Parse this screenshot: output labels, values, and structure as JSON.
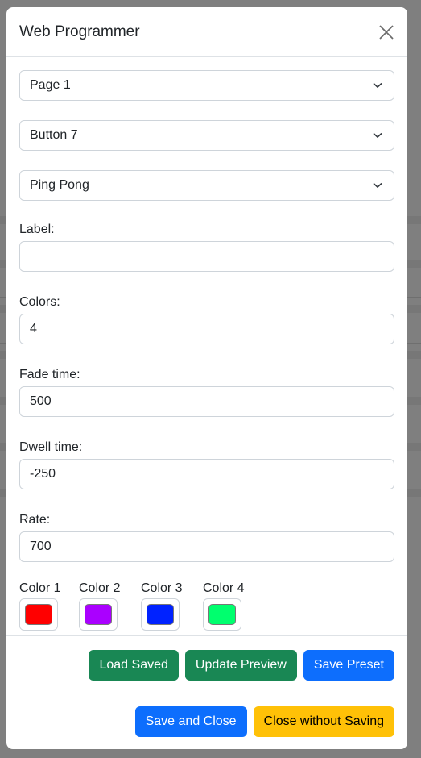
{
  "modal": {
    "title": "Web Programmer",
    "close_icon": "close-x-icon"
  },
  "selects": {
    "page": "Page 1",
    "button": "Button 7",
    "mode": "Ping Pong"
  },
  "fields": {
    "label": {
      "label": "Label:",
      "value": ""
    },
    "colors": {
      "label": "Colors:",
      "value": "4"
    },
    "fade_time": {
      "label": "Fade time:",
      "value": "500"
    },
    "dwell_time": {
      "label": "Dwell time:",
      "value": "-250"
    },
    "rate": {
      "label": "Rate:",
      "value": "700"
    }
  },
  "color_pickers": [
    {
      "label": "Color 1",
      "color": "#ff0000"
    },
    {
      "label": "Color 2",
      "color": "#aa00ff"
    },
    {
      "label": "Color 3",
      "color": "#0022ff"
    },
    {
      "label": "Color 4",
      "color": "#00ff6e"
    }
  ],
  "actions": {
    "load_saved": "Load Saved",
    "update_preview": "Update Preview",
    "save_preset": "Save Preset",
    "save_and_close": "Save and Close",
    "close_without_saving": "Close without Saving"
  },
  "colors": {
    "success": "#198754",
    "primary": "#0d6efd",
    "warning": "#ffc107",
    "backdrop": "#7f7f7f"
  }
}
